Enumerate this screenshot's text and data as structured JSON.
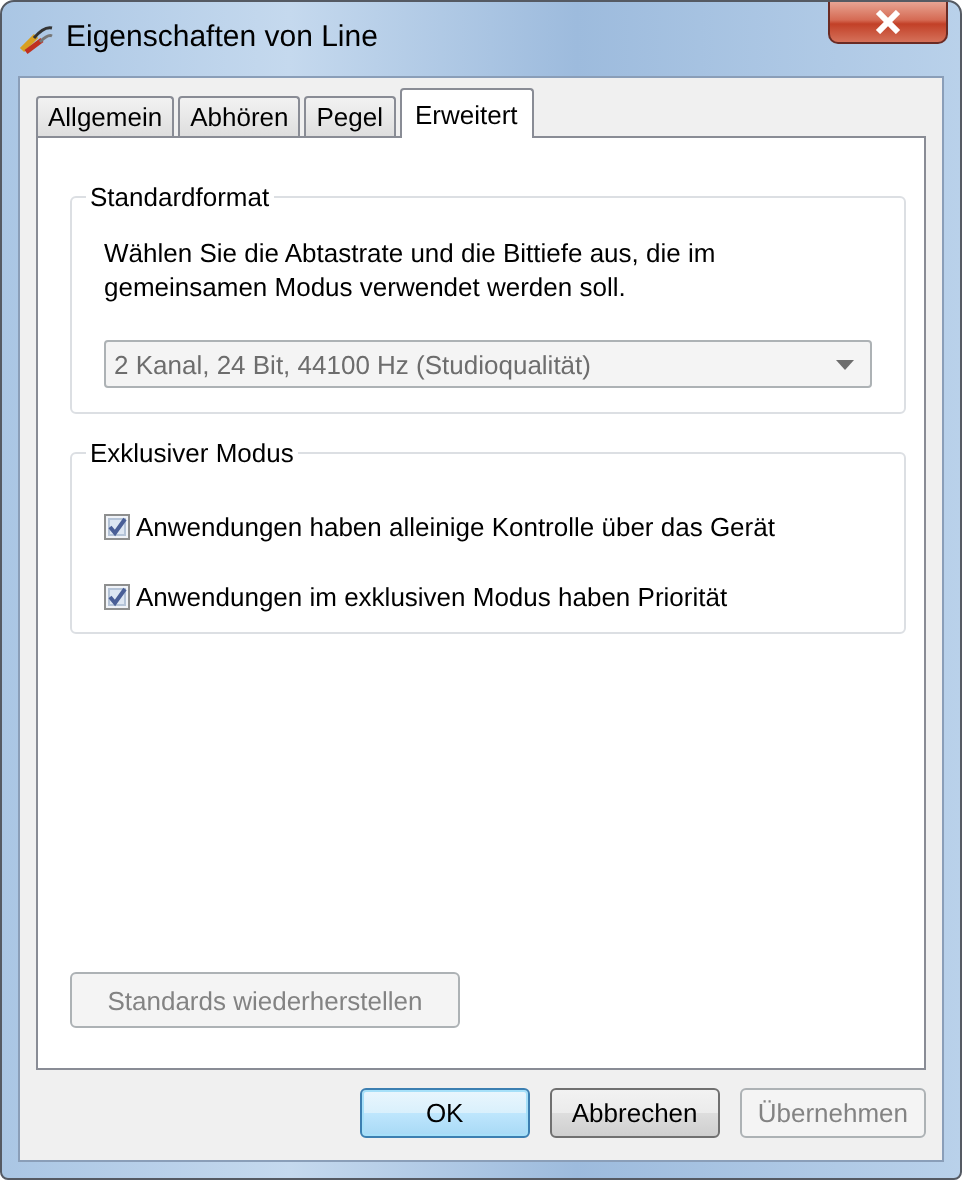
{
  "window": {
    "title": "Eigenschaften von Line"
  },
  "tabs": [
    {
      "label": "Allgemein",
      "selected": false
    },
    {
      "label": "Abhören",
      "selected": false
    },
    {
      "label": "Pegel",
      "selected": false
    },
    {
      "label": "Erweitert",
      "selected": true
    }
  ],
  "standard_format": {
    "title": "Standardformat",
    "description": "Wählen Sie die Abtastrate und die Bittiefe aus, die im gemeinsamen Modus verwendet werden soll.",
    "format": {
      "value": "2 Kanal, 24 Bit, 44100 Hz (Studioqualität)",
      "disabled": true
    }
  },
  "exclusive_mode": {
    "title": "Exklusiver Modus",
    "options": [
      {
        "label": "Anwendungen haben alleinige Kontrolle über das Gerät",
        "checked": true
      },
      {
        "label": "Anwendungen im exklusiven Modus haben Priorität",
        "checked": true
      }
    ]
  },
  "restore_defaults": {
    "label": "Standards wiederherstellen",
    "disabled": true
  },
  "buttons": [
    {
      "label": "OK",
      "default": true,
      "disabled": false
    },
    {
      "label": "Abbrechen",
      "default": false,
      "disabled": false
    },
    {
      "label": "Übernehmen",
      "default": false,
      "disabled": true
    }
  ]
}
